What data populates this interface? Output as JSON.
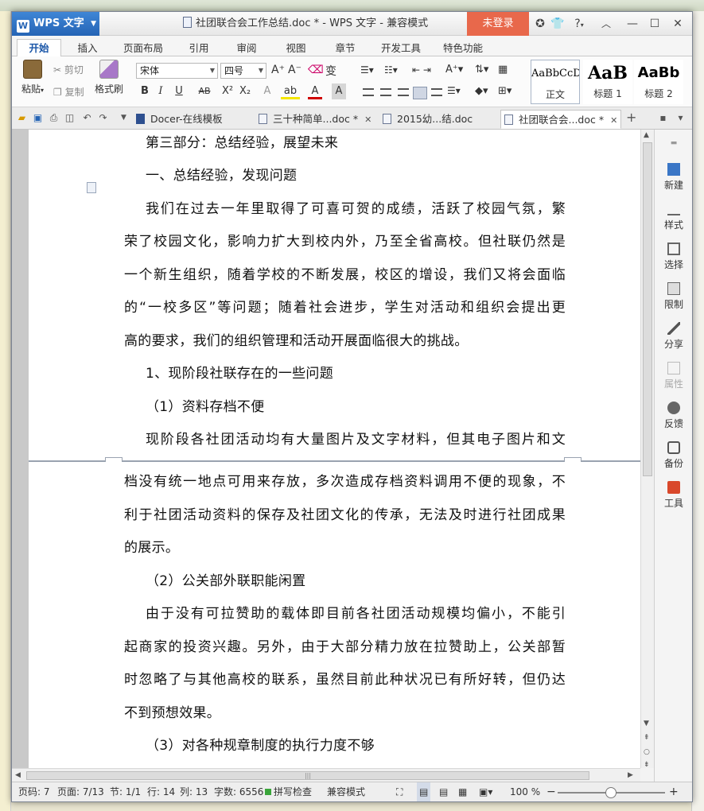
{
  "app": {
    "name": "WPS 文字",
    "window_title": "社团联合会工作总结.doc * - WPS 文字 - 兼容模式",
    "login_label": "未登录",
    "help_label": "?"
  },
  "tabs": [
    "开始",
    "插入",
    "页面布局",
    "引用",
    "审阅",
    "视图",
    "章节",
    "开发工具",
    "特色功能"
  ],
  "ribbon": {
    "paste": "粘贴",
    "cut": "剪切",
    "copy": "复制",
    "format_painter": "格式刷",
    "font_name": "宋体",
    "font_size": "四号",
    "styles": [
      {
        "preview": "AaBbCcD",
        "label": "正文"
      },
      {
        "preview": "AaB",
        "label": "标题 1"
      },
      {
        "preview": "AaBb",
        "label": "标题 2"
      }
    ]
  },
  "doc_tabs": [
    {
      "label": "Docer-在线模板",
      "closable": false
    },
    {
      "label": "三十种简单...doc *",
      "closable": true
    },
    {
      "label": "2015幼...结.doc",
      "closable": false
    },
    {
      "label": "社团联合会...doc *",
      "closable": true
    }
  ],
  "document": {
    "page1_lines": [
      "第三部分：总结经验，展望未来",
      "一、总结经验，发现问题",
      "我们在过去一年里取得了可喜可贺的成绩，活跃了校园气氛，繁",
      "荣了校园文化，影响力扩大到校内外，乃至全省高校。但社联仍然是",
      "一个新生组织，随着学校的不断发展，校区的增设，我们又将会面临",
      "的“一校多区”等问题；随着社会进步，学生对活动和组织会提出更",
      "高的要求，我们的组织管理和活动开展面临很大的挑战。",
      "1、现阶段社联存在的一些问题",
      "（1）资料存档不便",
      "现阶段各社团活动均有大量图片及文字材料，但其电子图片和文"
    ],
    "page2_lines": [
      "档没有统一地点可用来存放，多次造成存档资料调用不便的现象，不",
      "利于社团活动资料的保存及社团文化的传承，无法及时进行社团成果",
      "的展示。",
      "（2）公关部外联职能闲置",
      "由于没有可拉赞助的载体即目前各社团活动规模均偏小，不能引",
      "起商家的投资兴趣。另外，由于大部分精力放在拉赞助上，公关部暂",
      "时忽略了与其他高校的联系，虽然目前此种状况已有所好转，但仍达",
      "不到预想效果。",
      "（3）对各种规章制度的执行力度不够"
    ]
  },
  "right_panel": [
    "新建",
    "样式",
    "选择",
    "限制",
    "分享",
    "属性",
    "反馈",
    "备份",
    "工具"
  ],
  "status": {
    "page_code": "页码: 7",
    "page": "页面: 7/13",
    "section": "节: 1/1",
    "row": "行: 14",
    "col": "列: 13",
    "word_count": "字数: 6556",
    "spell": "拼写检查",
    "compat": "兼容模式",
    "zoom": "100 %"
  },
  "colors": {
    "accent": "#2564b5",
    "login": "#e8684b"
  }
}
